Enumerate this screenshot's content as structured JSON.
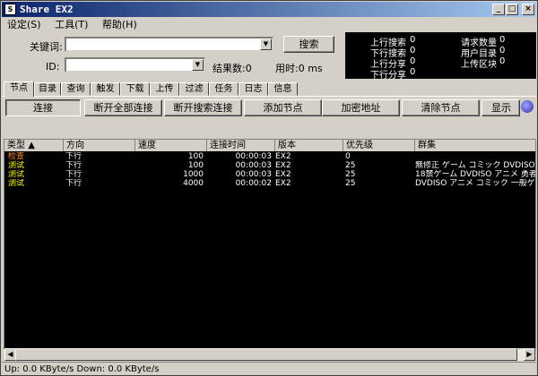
{
  "window": {
    "title": "Share EX2"
  },
  "menu": [
    "设定(S)",
    "工具(T)",
    "帮助(H)"
  ],
  "search": {
    "keyword_label": "关键词:",
    "id_label": "ID:",
    "search_button": "搜索",
    "result_count": "结果数:0",
    "time_used": "用时:0 ms",
    "keyword_value": "",
    "id_value": ""
  },
  "stats": {
    "up_search": "上行搜索",
    "up_search_v": "0",
    "down_search": "下行搜索",
    "down_search_v": "0",
    "up_share": "上行分享",
    "up_share_v": "0",
    "down_share": "下行分享",
    "down_share_v": "0",
    "req_count": "请求数量",
    "req_count_v": "0",
    "user_dir": "用户目录",
    "user_dir_v": "0",
    "upload_block": "上传区块",
    "upload_block_v": "0"
  },
  "tabs": [
    "节点",
    "目录",
    "查询",
    "触发",
    "下载",
    "上传",
    "过滤",
    "任务",
    "日志",
    "信息"
  ],
  "toolbar": {
    "connect": "连接",
    "disconnect_all": "断开全部连接",
    "disconnect_search": "断开搜索连接",
    "add_node": "添加节点",
    "encrypt_addr": "加密地址",
    "clear_nodes": "清除节点",
    "show": "显示并"
  },
  "table": {
    "headers": [
      "类型",
      "方向",
      "速度",
      "连接时间",
      "版本",
      "优先级",
      "群集"
    ],
    "rows": [
      {
        "type": "检查",
        "dir": "下行",
        "speed": "100",
        "time": "00:00:03",
        "ver": "EX2",
        "prio": "0",
        "cluster": "",
        "color": "#ff8c1a"
      },
      {
        "type": "测试",
        "dir": "下行",
        "speed": "100",
        "time": "00:00:03",
        "ver": "EX2",
        "prio": "25",
        "cluster": "無修正 ゲーム コミック DVDISO",
        "color": "#ffff00"
      },
      {
        "type": "测试",
        "dir": "下行",
        "speed": "1000",
        "time": "00:00:03",
        "ver": "EX2",
        "prio": "25",
        "cluster": "18禁ゲーム DVDISO アニメ 勇者",
        "color": "#ffff00"
      },
      {
        "type": "测试",
        "dir": "下行",
        "speed": "4000",
        "time": "00:00:02",
        "ver": "EX2",
        "prio": "25",
        "cluster": "DVDISO アニメ コミック 一般ゲ",
        "color": "#ffff00"
      }
    ]
  },
  "status": "Up: 0.0 KByte/s Down: 0.0 KByte/s"
}
